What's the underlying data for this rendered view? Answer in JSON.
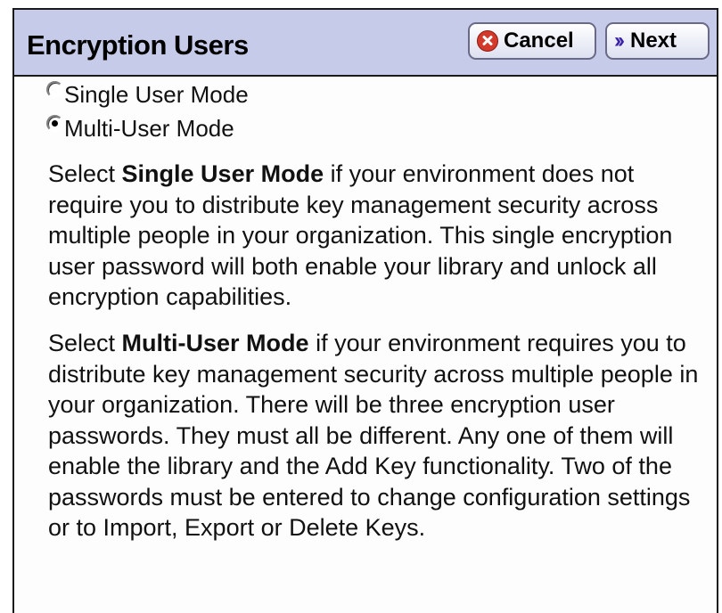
{
  "header": {
    "title": "Encryption Users",
    "cancel_label": "Cancel",
    "next_label": "Next",
    "cancel_icon": "cancel-icon",
    "next_icon": "double-chevron-right-icon"
  },
  "mode": {
    "options": [
      {
        "label": "Single User Mode",
        "selected": false
      },
      {
        "label": "Multi-User Mode",
        "selected": true
      }
    ]
  },
  "descriptions": {
    "single": {
      "prefix": "Select ",
      "bold": "Single User Mode",
      "rest": " if your environment does not require you to distribute key management security across multiple people in your organization. This single encryption user password will both enable your library and unlock all encryption capabilities."
    },
    "multi": {
      "prefix": "Select ",
      "bold": "Multi-User Mode",
      "rest": " if your environment requires you to distribute key management security across multiple people in your organization. There will be three encryption user passwords. They must all be different. Any one of them will enable the library and the Add Key functionality. Two of the passwords must be entered to change configuration settings or to Import, Export or Delete Keys."
    }
  },
  "colors": {
    "header_bg": "#c5cbe8",
    "cancel_icon": "#d33a2c",
    "next_icon": "#3a22a8"
  }
}
